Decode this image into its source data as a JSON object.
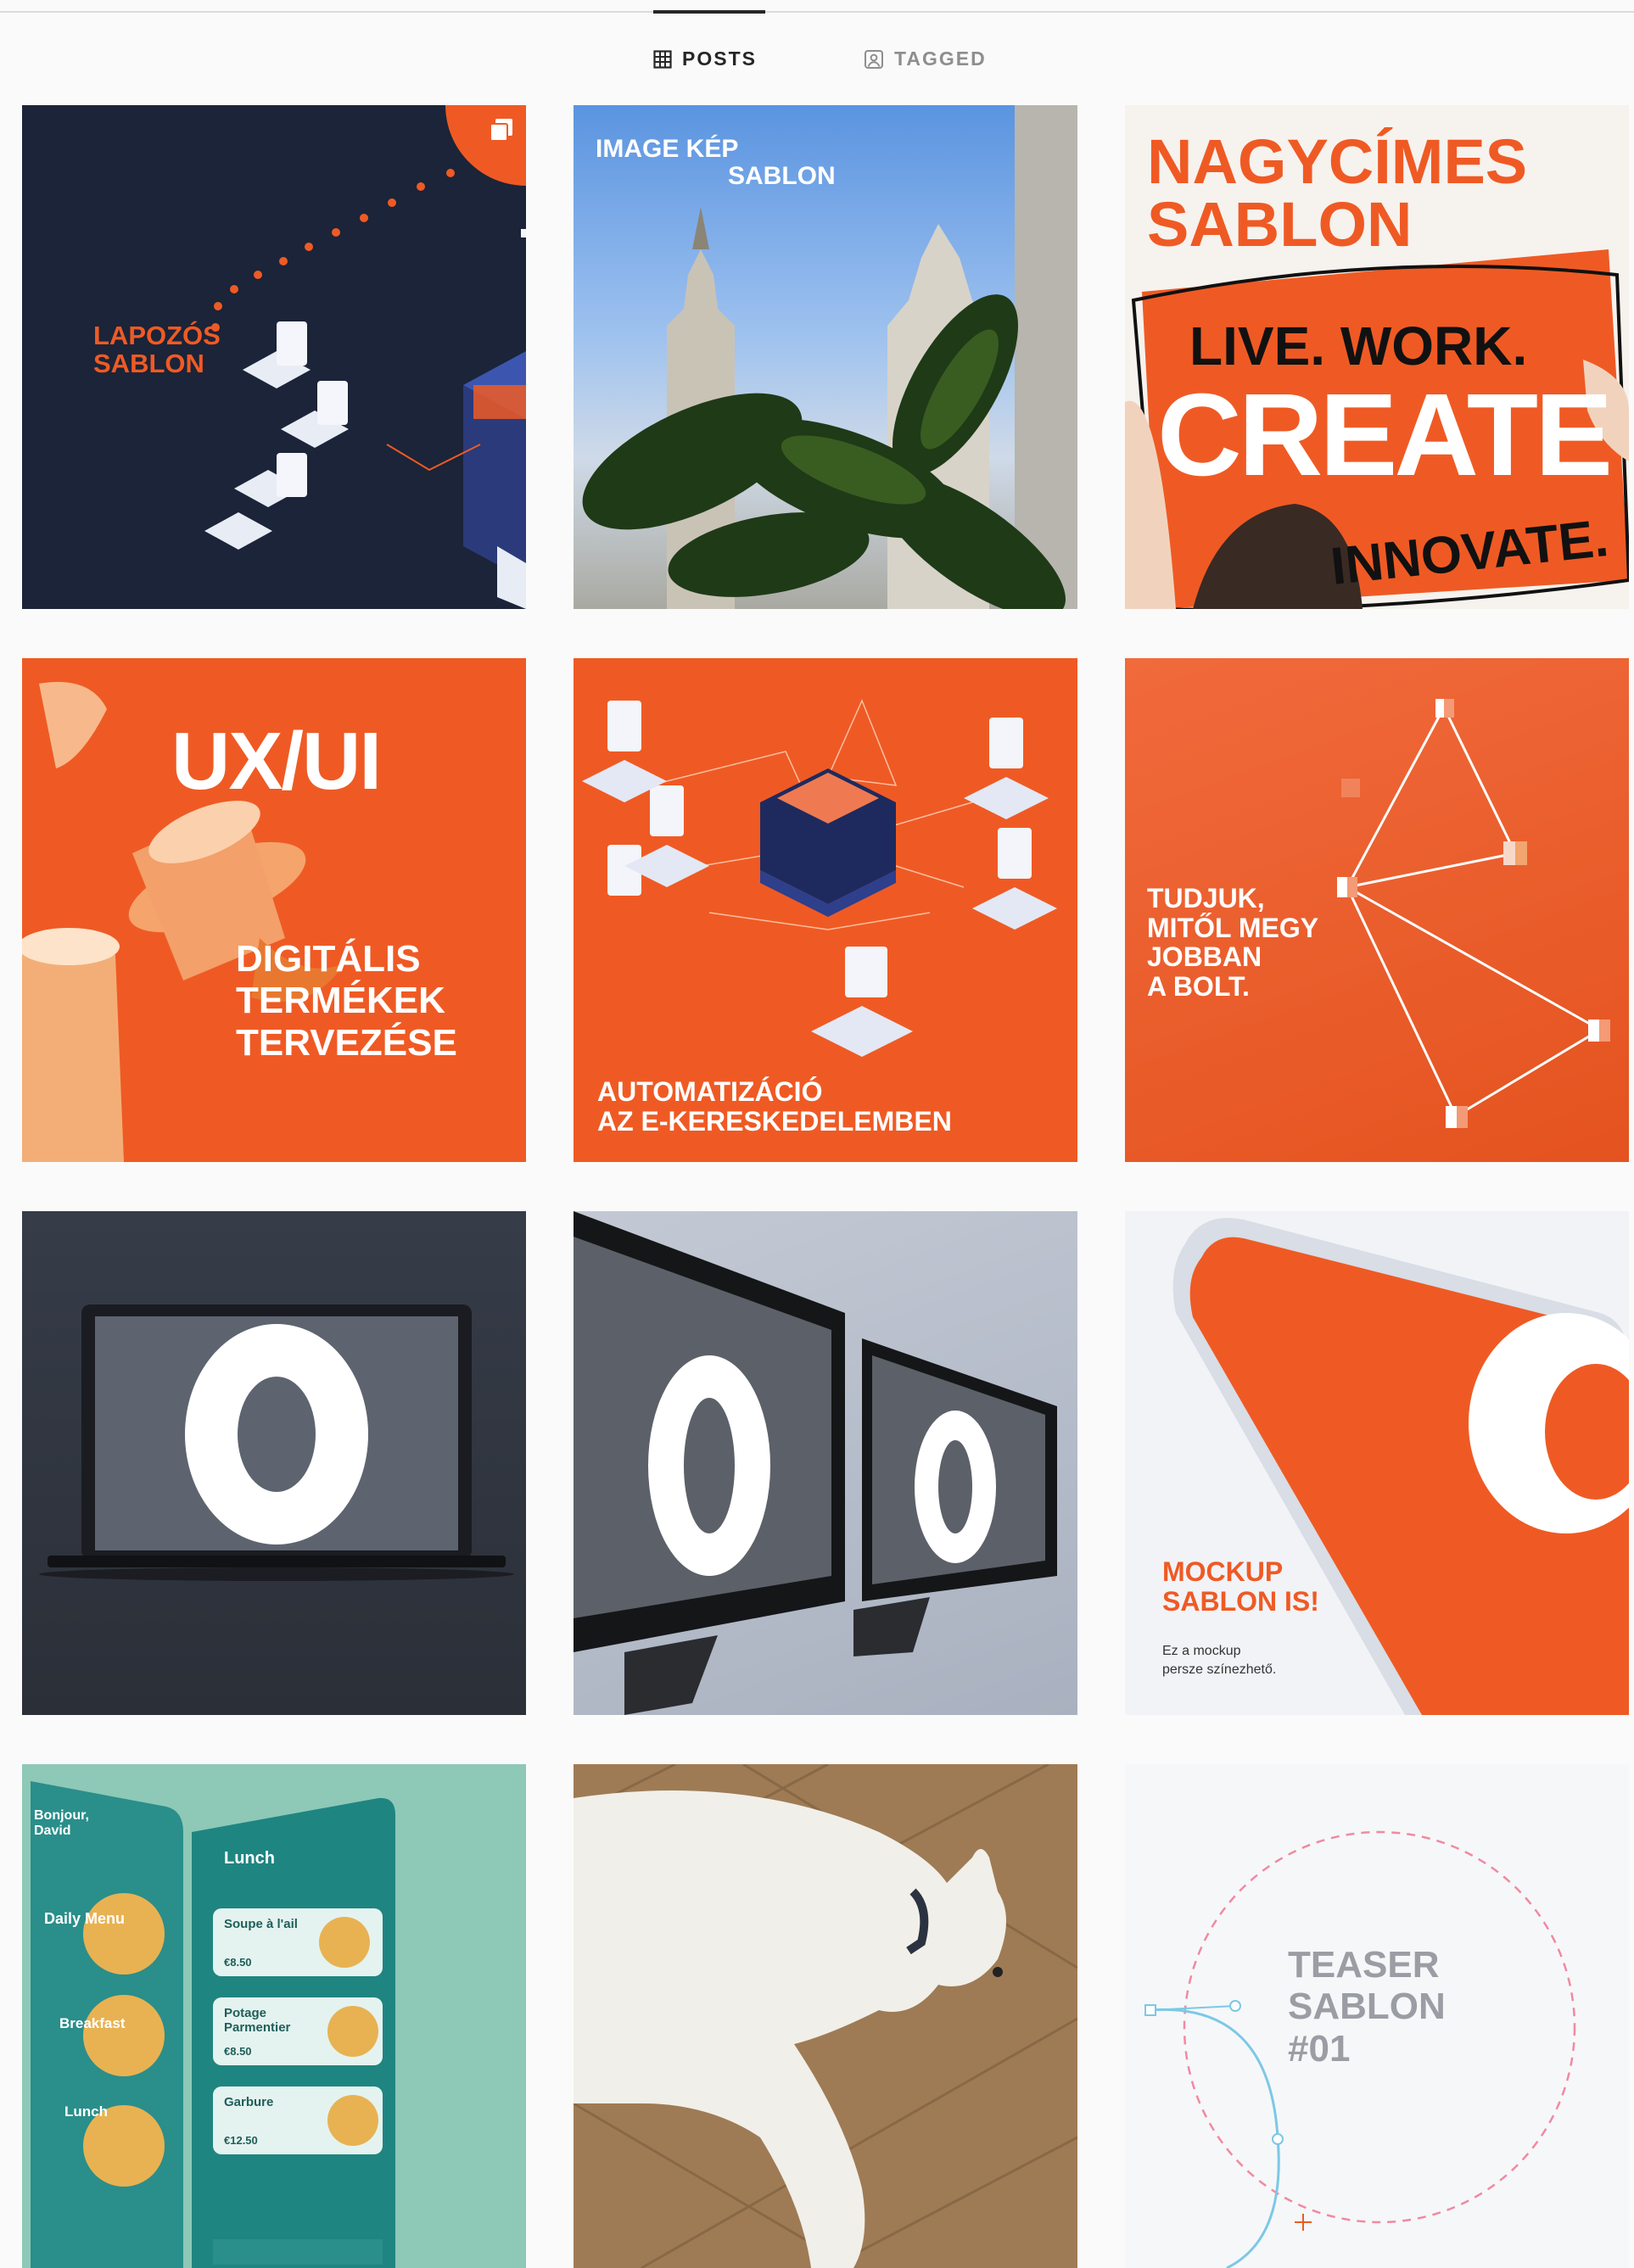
{
  "tabs": {
    "posts_label": "POSTS",
    "tagged_label": "TAGGED"
  },
  "posts": [
    {
      "lines": [
        "LAPOZÓS",
        "SABLON"
      ]
    },
    {
      "lines": [
        "IMAGE KÉP",
        "SABLON"
      ]
    },
    {
      "lines": [
        "NAGYCÍMES",
        "SABLON"
      ],
      "sign_lines": [
        "LIVE. WORK.",
        "CREATE",
        "INNOVATE."
      ]
    },
    {
      "lines": [
        "DIGITÁLIS",
        "TERMÉKEK",
        "TERVEZÉSE"
      ],
      "logo": "UX/UI"
    },
    {
      "lines": [
        "AUTOMATIZÁCIÓ",
        "AZ E-KERESKEDELEMBEN"
      ]
    },
    {
      "lines": [
        "TUDJUK,",
        "MITŐL MEGY",
        "JOBBAN",
        "A BOLT."
      ]
    },
    {
      "lines": []
    },
    {
      "lines": []
    },
    {
      "lines": [
        "MOCKUP",
        "SABLON IS!"
      ],
      "caption": [
        "Ez a mockup",
        "persze színezhető."
      ]
    },
    {
      "lines": [],
      "screen_text": [
        "Bonjour, David",
        "Daily Menu",
        "Breakfast",
        "Lunch",
        "Lunch",
        "Soupe à l'ail",
        "Potage Parmentier",
        "Garbure",
        "€8.50",
        "€8.50",
        "€12.50"
      ]
    },
    {
      "lines": []
    },
    {
      "lines": [
        "TEASER",
        "SABLON",
        "#01"
      ]
    }
  ],
  "colors": {
    "brand_orange": "#ef5a24",
    "navy": "#1b2438",
    "active_tab": "#262626",
    "inactive_tab": "#8e8e8e"
  },
  "icons": {
    "posts": "grid-icon",
    "tagged": "tagged-person-icon",
    "carousel": "carousel-icon"
  }
}
